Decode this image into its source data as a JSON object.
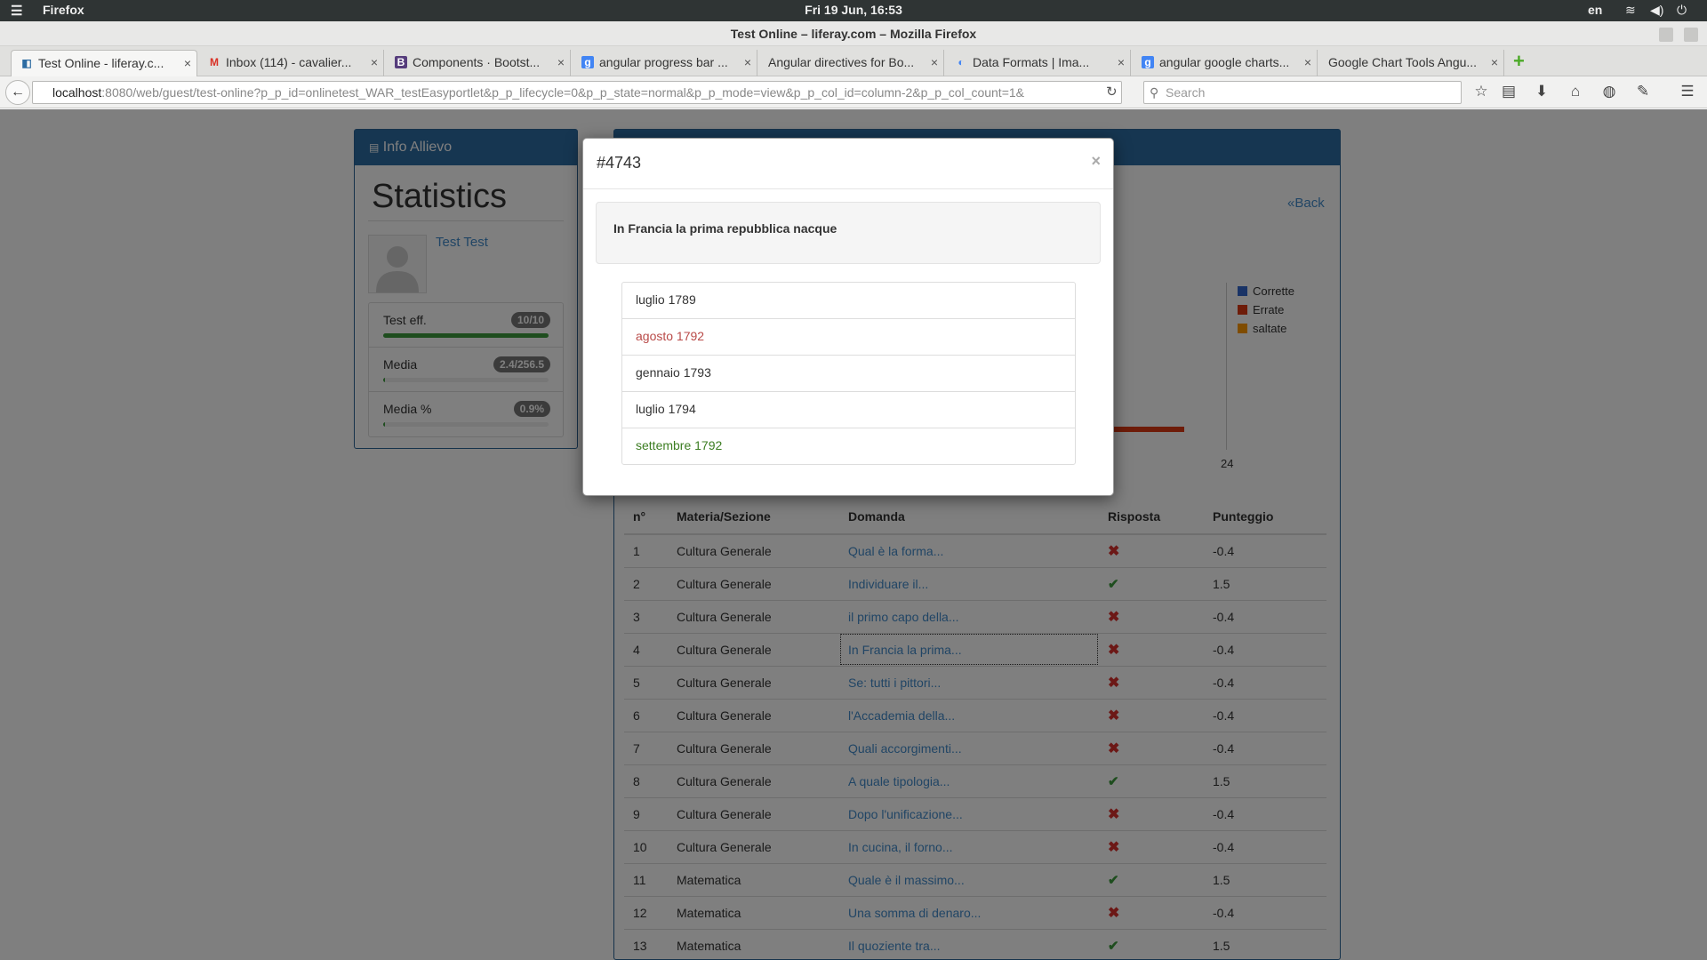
{
  "os": {
    "menu_icon": "hamburger-icon",
    "app": "Firefox",
    "clock": "Fri 19 Jun, 16:53",
    "lang": "en"
  },
  "window": {
    "title": "Test Online – liferay.com – Mozilla Firefox"
  },
  "tabs": [
    {
      "label": "Test Online - liferay.c...",
      "icon": "liferay-icon"
    },
    {
      "label": "Inbox (114) - cavalier...",
      "icon": "gmail-icon"
    },
    {
      "label": "Components · Bootst...",
      "icon": "bootstrap-icon"
    },
    {
      "label": "angular progress bar ...",
      "icon": "google-icon"
    },
    {
      "label": "Angular directives for Bo...",
      "icon": "none"
    },
    {
      "label": "Data Formats  |  Ima...",
      "icon": "chrome-icon"
    },
    {
      "label": "angular google charts...",
      "icon": "google-icon"
    },
    {
      "label": "Google Chart Tools Angu...",
      "icon": "none"
    }
  ],
  "nav": {
    "url_host": "localhost",
    "url_rest": ":8080/web/guest/test-online?p_p_id=onlinetest_WAR_testEasyportlet&p_p_lifecycle=0&p_p_state=normal&p_p_mode=view&p_p_col_id=column-2&p_p_col_count=1&",
    "search_placeholder": "Search"
  },
  "left_panel": {
    "header": "Info Allievo",
    "title": "Statistics",
    "user": "Test Test",
    "stats": [
      {
        "label": "Test eff.",
        "badge": "10/10",
        "progress": 1.0
      },
      {
        "label": "Media",
        "badge": "2.4/256.5",
        "progress": 0.01
      },
      {
        "label": "Media %",
        "badge": "0.9%",
        "progress": 0.009
      }
    ]
  },
  "right_panel": {
    "back": "«Back",
    "legend": [
      {
        "label": "Corrette",
        "color": "#3366cc"
      },
      {
        "label": "Errate",
        "color": "#dc3912"
      },
      {
        "label": "saltate",
        "color": "#ff9900"
      }
    ],
    "axis_tick": "24",
    "table": {
      "headers": [
        "n°",
        "Materia/Sezione",
        "Domanda",
        "Risposta",
        "Punteggio"
      ],
      "rows": [
        {
          "n": "1",
          "materia": "Cultura Generale",
          "domanda": "Qual è la forma...",
          "ok": false,
          "punti": "-0.4"
        },
        {
          "n": "2",
          "materia": "Cultura Generale",
          "domanda": "Individuare il...",
          "ok": true,
          "punti": "1.5"
        },
        {
          "n": "3",
          "materia": "Cultura Generale",
          "domanda": "il primo capo della...",
          "ok": false,
          "punti": "-0.4"
        },
        {
          "n": "4",
          "materia": "Cultura Generale",
          "domanda": "In Francia la prima...",
          "ok": false,
          "punti": "-0.4"
        },
        {
          "n": "5",
          "materia": "Cultura Generale",
          "domanda": "Se: tutti i pittori...",
          "ok": false,
          "punti": "-0.4"
        },
        {
          "n": "6",
          "materia": "Cultura Generale",
          "domanda": "l'Accademia della...",
          "ok": false,
          "punti": "-0.4"
        },
        {
          "n": "7",
          "materia": "Cultura Generale",
          "domanda": "  Quali accorgimenti...",
          "ok": false,
          "punti": "-0.4"
        },
        {
          "n": "8",
          "materia": "Cultura Generale",
          "domanda": "A quale tipologia...",
          "ok": true,
          "punti": "1.5"
        },
        {
          "n": "9",
          "materia": "Cultura Generale",
          "domanda": "  Dopo l'unificazione...",
          "ok": false,
          "punti": "-0.4"
        },
        {
          "n": "10",
          "materia": "Cultura Generale",
          "domanda": "In cucina, il forno...",
          "ok": false,
          "punti": "-0.4"
        },
        {
          "n": "11",
          "materia": "Matematica",
          "domanda": "Quale è il massimo...",
          "ok": true,
          "punti": "1.5"
        },
        {
          "n": "12",
          "materia": "Matematica",
          "domanda": "Una somma di denaro...",
          "ok": false,
          "punti": "-0.4"
        },
        {
          "n": "13",
          "materia": "Matematica",
          "domanda": "Il quoziente tra...",
          "ok": true,
          "punti": "1.5"
        }
      ]
    }
  },
  "modal": {
    "title": "#4743",
    "close": "×",
    "question": "In Francia la prima repubblica nacque",
    "options": [
      {
        "text": "luglio 1789",
        "state": "neutral"
      },
      {
        "text": "agosto 1792",
        "state": "wrong"
      },
      {
        "text": "gennaio 1793",
        "state": "neutral"
      },
      {
        "text": "luglio 1794",
        "state": "neutral"
      },
      {
        "text": "settembre 1792",
        "state": "right"
      }
    ]
  }
}
